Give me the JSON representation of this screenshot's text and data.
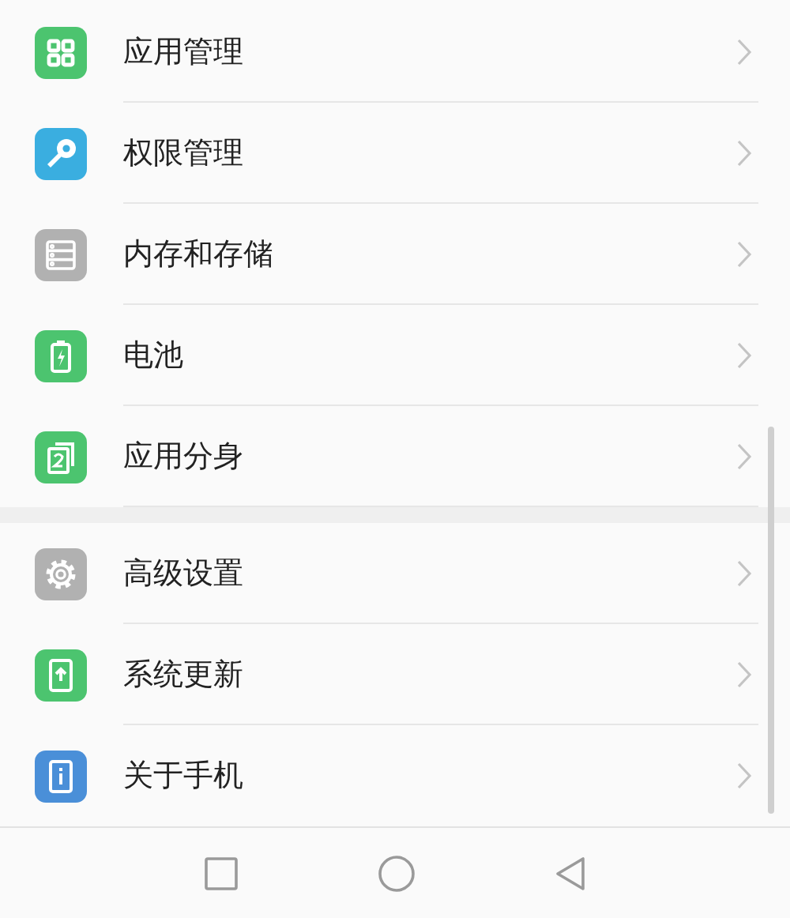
{
  "groups": [
    {
      "items": [
        {
          "label": "应用管理",
          "kind": "grid",
          "color": "#4cc46f"
        },
        {
          "label": "权限管理",
          "kind": "key",
          "color": "#3aaee0"
        },
        {
          "label": "内存和存储",
          "kind": "storage",
          "color": "#b1b1b1"
        },
        {
          "label": "电池",
          "kind": "battery",
          "color": "#4cc46f"
        },
        {
          "label": "应用分身",
          "kind": "clone",
          "color": "#4cc46f"
        }
      ]
    },
    {
      "items": [
        {
          "label": "高级设置",
          "kind": "gear",
          "color": "#b1b1b1"
        },
        {
          "label": "系统更新",
          "kind": "update",
          "color": "#4cc46f"
        },
        {
          "label": "关于手机",
          "kind": "info",
          "color": "#4a8fd8"
        }
      ]
    }
  ]
}
